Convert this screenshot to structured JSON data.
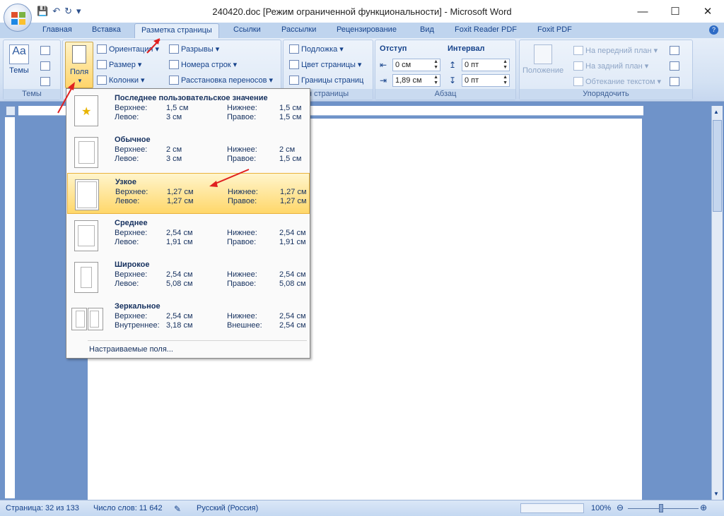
{
  "window": {
    "title": "240420.doc [Режим ограниченной функциональности] - Microsoft Word",
    "minimize": "—",
    "maximize": "☐",
    "close": "✕"
  },
  "tabs": [
    "Главная",
    "Вставка",
    "Разметка страницы",
    "Ссылки",
    "Рассылки",
    "Рецензирование",
    "Вид",
    "Foxit Reader PDF",
    "Foxit PDF"
  ],
  "ribbon": {
    "themes": {
      "label": "Темы",
      "group": "Темы"
    },
    "page_setup": {
      "margins": "Поля",
      "orientation": "Ориентация",
      "size": "Размер",
      "columns": "Колонки",
      "breaks": "Разрывы",
      "line_numbers": "Номера строк",
      "hyphenation": "Расстановка переносов"
    },
    "page_background": {
      "watermark": "Подложка",
      "page_color": "Цвет страницы",
      "page_borders": "Границы страниц",
      "group": "н страницы"
    },
    "paragraph": {
      "indent": "Отступ",
      "spacing": "Интервал",
      "indent_left": "0 см",
      "indent_right": "1,89 см",
      "space_before": "0 пт",
      "space_after": "0 пт",
      "group": "Абзац"
    },
    "arrange": {
      "position": "Положение",
      "bring_front": "На передний план",
      "send_back": "На задний план",
      "text_wrap": "Обтекание текстом",
      "group": "Упорядочить"
    }
  },
  "margins_menu": {
    "items": [
      {
        "name": "Последнее пользовательское значение",
        "top_l": "Верхнее:",
        "top": "1,5 см",
        "bottom_l": "Нижнее:",
        "bottom": "1,5 см",
        "left_l": "Левое:",
        "left": "3 см",
        "right_l": "Правое:",
        "right": "1,5 см"
      },
      {
        "name": "Обычное",
        "top_l": "Верхнее:",
        "top": "2 см",
        "bottom_l": "Нижнее:",
        "bottom": "2 см",
        "left_l": "Левое:",
        "left": "3 см",
        "right_l": "Правое:",
        "right": "1,5 см"
      },
      {
        "name": "Узкое",
        "top_l": "Верхнее:",
        "top": "1,27 см",
        "bottom_l": "Нижнее:",
        "bottom": "1,27 см",
        "left_l": "Левое:",
        "left": "1,27 см",
        "right_l": "Правое:",
        "right": "1,27 см"
      },
      {
        "name": "Среднее",
        "top_l": "Верхнее:",
        "top": "2,54 см",
        "bottom_l": "Нижнее:",
        "bottom": "2,54 см",
        "left_l": "Левое:",
        "left": "1,91 см",
        "right_l": "Правое:",
        "right": "1,91 см"
      },
      {
        "name": "Широкое",
        "top_l": "Верхнее:",
        "top": "2,54 см",
        "bottom_l": "Нижнее:",
        "bottom": "2,54 см",
        "left_l": "Левое:",
        "left": "5,08 см",
        "right_l": "Правое:",
        "right": "5,08 см"
      },
      {
        "name": "Зеркальное",
        "top_l": "Верхнее:",
        "top": "2,54 см",
        "bottom_l": "Нижнее:",
        "bottom": "2,54 см",
        "left_l": "Внутреннее:",
        "left": "3,18 см",
        "right_l": "Внешнее:",
        "right": "2,54 см"
      }
    ],
    "custom": "Настраиваемые поля..."
  },
  "status": {
    "page": "Страница: 32 из 133",
    "words": "Число слов: 11 642",
    "lang": "Русский (Россия)",
    "zoom": "100%"
  },
  "accent": "#ffd76a"
}
